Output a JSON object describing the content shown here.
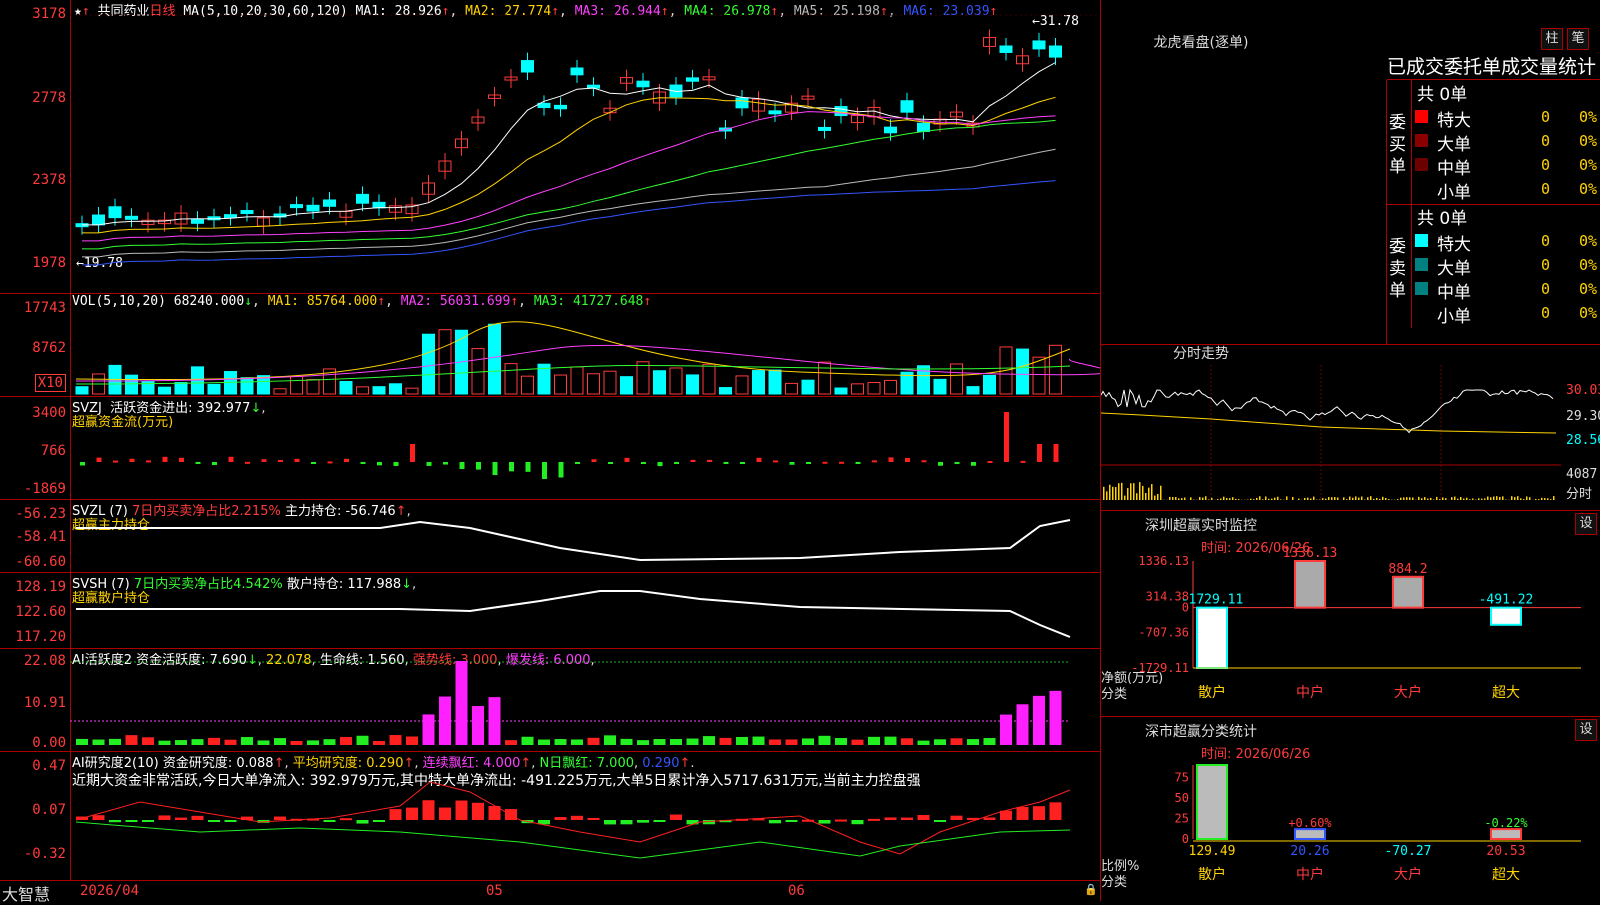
{
  "stock": {
    "name": "共同药业",
    "period": "日线",
    "ma_label": "MA(5,10,20,30,60,120)",
    "ma_values": [
      "MA1: 28.926",
      "MA2: 27.774",
      "MA3: 26.944",
      "MA4: 26.978",
      "MA5: 25.198",
      "MA6: 23.039"
    ],
    "high_marker": "31.78",
    "low_marker": "19.78",
    "axis_ticks": [
      "3178",
      "2778",
      "2378",
      "1978"
    ]
  },
  "volume": {
    "label": "VOL(5,10,20)",
    "value": "68240.000",
    "ma1": "MA1: 85764.000",
    "ma2": "MA2: 56031.699",
    "ma3": "MA3: 41727.648",
    "axis_ticks": [
      "17743",
      "8762"
    ],
    "unit": "X10"
  },
  "svzj": {
    "label": "SVZJ",
    "desc": "活跃资金进出: 392.977",
    "subtitle": "超赢资金流(万元)",
    "axis_ticks": [
      "3400",
      "766",
      "-1869"
    ]
  },
  "svzl": {
    "label": "SVZL (7)",
    "desc": "7日内买卖净占比2.215%",
    "value": "主力持仓: -56.746",
    "subtitle": "超赢主力持仓",
    "axis_ticks": [
      "-56.23",
      "-58.41",
      "-60.60"
    ]
  },
  "svsh": {
    "label": "SVSH (7)",
    "desc": "7日内买卖净占比4.542%",
    "value": "散户持仓: 117.988",
    "subtitle": "超赢散户持仓",
    "axis_ticks": [
      "128.19",
      "122.60",
      "117.20"
    ]
  },
  "ai_active": {
    "label": "AI活跃度2",
    "value": "资金活跃度: 7.690",
    "v2": "22.078",
    "life": "生命线: 1.560",
    "strong": "强势线: 3.000",
    "burst": "爆发线: 6.000",
    "axis_ticks": [
      "22.08",
      "10.91",
      "0.00"
    ]
  },
  "ai_research": {
    "label": "AI研究度2(10)",
    "value": "资金研究度: 0.088",
    "avg": "平均研究度: 0.290",
    "cont": "连续飘红: 4.000",
    "nday": "N日飘红: 7.000",
    "extra": "0.290",
    "summary": "近期大资金非常活跃,今日大单净流入: 392.979万元,其中特大单净流出: -491.225万元,大单5日累计净入5717.631万元,当前主力控盘强",
    "axis_ticks": [
      "0.47",
      "0.07",
      "-0.32"
    ]
  },
  "date_axis": [
    "2026/04",
    "05",
    "06"
  ],
  "footer_brand": "大智慧",
  "dragon": {
    "title": "龙虎看盘(逐单)",
    "btn_bar": "柱",
    "btn_pen": "笔",
    "header": "已成交委托单成交量统计",
    "buy_label": "委买单",
    "sell_label": "委卖单",
    "buy_total": "共 0单",
    "sell_total": "共 0单",
    "rows": [
      {
        "name": "特大",
        "count": "0",
        "pct": "0%"
      },
      {
        "name": "大单",
        "count": "0",
        "pct": "0%"
      },
      {
        "name": "中单",
        "count": "0",
        "pct": "0%"
      },
      {
        "name": "小单",
        "count": "0",
        "pct": "0%"
      }
    ]
  },
  "intraday": {
    "title": "分时走势",
    "prices": [
      "30.03",
      "29.30",
      "28.56"
    ],
    "vol": "4087",
    "vol_label": "分时"
  },
  "sz_monitor": {
    "title": "深圳超赢实时监控",
    "set": "设",
    "time": "时间: 2026/06/26",
    "axis": [
      "1336.13",
      "314.38",
      "0",
      "-707.36",
      "-1729.11"
    ],
    "values": [
      "-1729.11",
      "1336.13",
      "884.2",
      "-491.22"
    ],
    "ylabel": "净额(万元)",
    "xlabel": "分类",
    "cats": [
      "散户",
      "中户",
      "大户",
      "超大"
    ]
  },
  "sz_stats": {
    "title": "深市超赢分类统计",
    "set": "设",
    "time": "时间: 2026/06/26",
    "axis": [
      "75",
      "50",
      "25",
      "0"
    ],
    "pct_labels": [
      "+0.60%",
      "-0.22%"
    ],
    "values": [
      "129.49",
      "20.26",
      "-70.27",
      "20.53"
    ],
    "ylabel": "比例%",
    "xlabel": "分类",
    "cats": [
      "散户",
      "中户",
      "大户",
      "超大"
    ]
  },
  "chart_data": {
    "type": "bar",
    "title": "深圳超赢实时监控",
    "categories": [
      "散户",
      "中户",
      "大户",
      "超大"
    ],
    "values": [
      -1729.11,
      1336.13,
      884.2,
      -491.22
    ],
    "ylabel": "净额(万元)",
    "xlabel": "分类",
    "ylim": [
      -1729.11,
      1336.13
    ]
  }
}
